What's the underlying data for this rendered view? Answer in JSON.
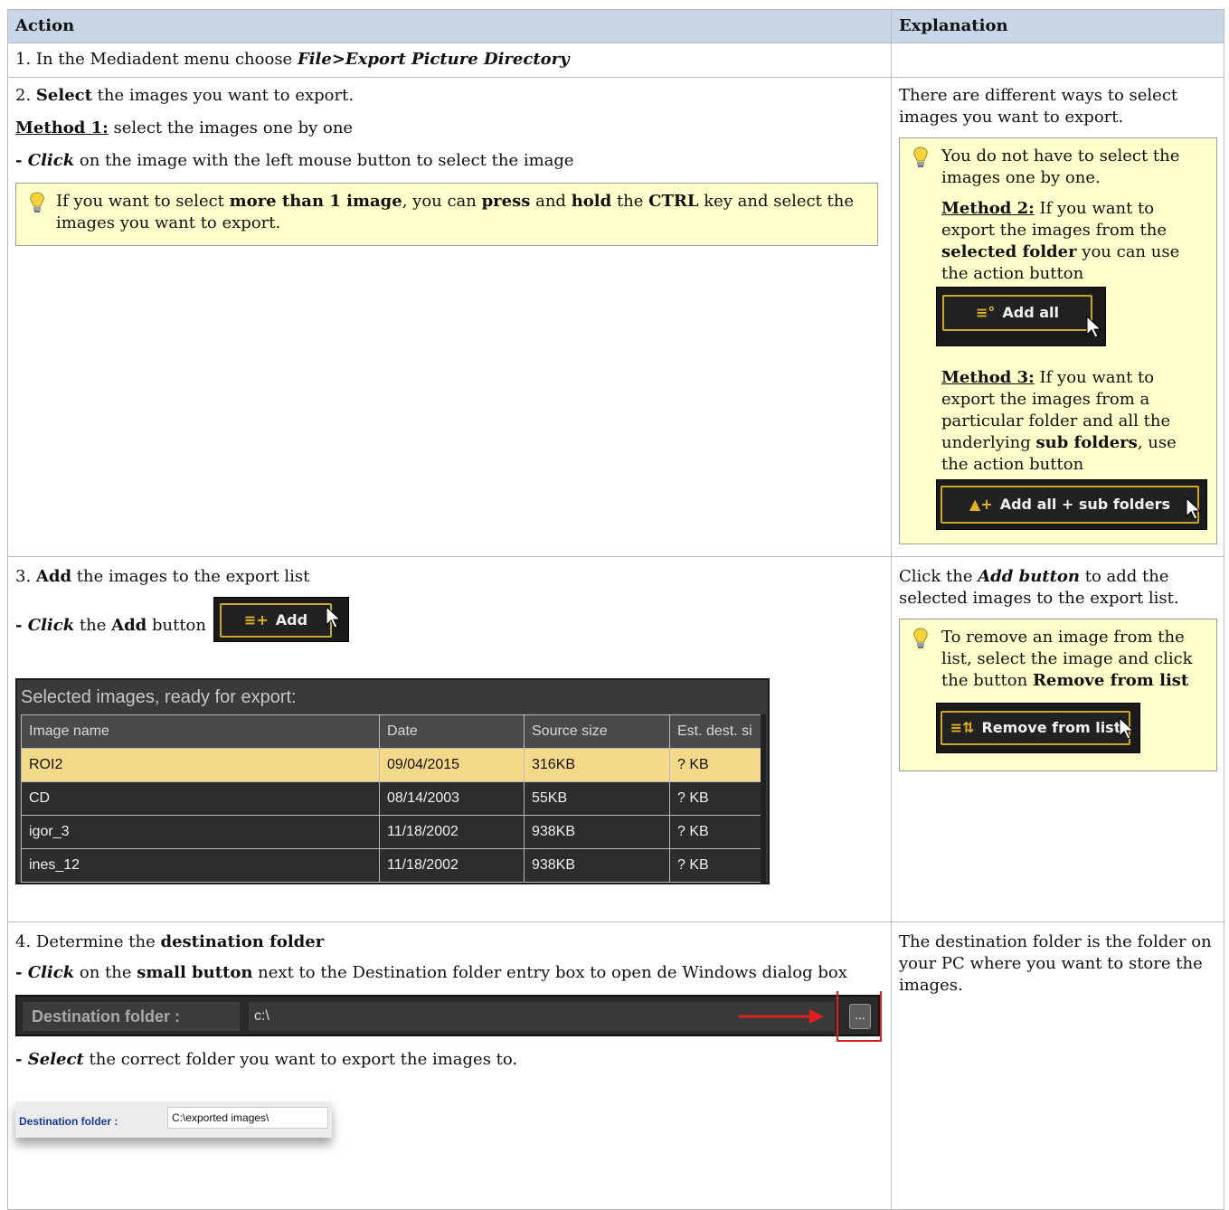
{
  "table": {
    "header": {
      "action": "Action",
      "explanation": "Explanation"
    },
    "row1": {
      "action": {
        "prefix": "1. In the Mediadent menu choose ",
        "menu_path": "File>Export Picture Directory"
      },
      "explanation": ""
    },
    "row2": {
      "step_num": "2. ",
      "step_bold": "Select",
      "step_rest": " the images you want to export.",
      "method1_label": "Method 1:",
      "method1_text": " select the images one by one",
      "click_dash": "- ",
      "click_word": "Click",
      "click_text": " on the image with the left mouse button to select the image",
      "tip": {
        "t1": "If you want to select ",
        "b1": "more than 1 image",
        "t2": ", you can ",
        "b2": "press",
        "t3": " and ",
        "b3": "hold",
        "t4": " the ",
        "b4": "CTRL",
        "t5": " key and select the images you want to export."
      },
      "explanation": {
        "intro": "There are different ways to select images you want to export.",
        "tip_line": "You do not have to select the images one by one.",
        "method2_label": "Method 2:",
        "method2_a": " If you want to export the images from the ",
        "method2_bold": "selected folder",
        "method2_b": " you can use the action button",
        "add_all_button": "Add all",
        "method3_label": "Method 3:",
        "method3_a": " If you want to export the images from a particular folder and all the underlying ",
        "method3_bold": "sub folders",
        "method3_b": ", use the action button",
        "add_all_sub_button": "Add all + sub folders"
      }
    },
    "row3": {
      "step_num": "3. ",
      "step_bold": "Add",
      "step_rest": " the images to the export list",
      "click_dash": "- ",
      "click_word": "Click",
      "click_mid": " the ",
      "click_bold": "Add",
      "click_end": " button",
      "add_button": "Add",
      "grid": {
        "title": "Selected images, ready for export:",
        "columns": [
          "Image name",
          "Date",
          "Source size",
          "Est. dest. si"
        ],
        "rows": [
          [
            "ROI2",
            "09/04/2015",
            "316KB",
            "? KB"
          ],
          [
            "CD",
            "08/14/2003",
            "55KB",
            "? KB"
          ],
          [
            "igor_3",
            "11/18/2002",
            "938KB",
            "? KB"
          ],
          [
            "ines_12",
            "11/18/2002",
            "938KB",
            "? KB"
          ]
        ],
        "selected_row": 0
      },
      "explanation": {
        "t1": "Click the ",
        "b1": "Add button",
        "t2": " to add the selected images to the export list.",
        "tip_a": "To remove an image from the list, select the image and click the button ",
        "tip_bold": "Remove from list",
        "remove_button": "Remove from list"
      }
    },
    "row4": {
      "step_num": "4. ",
      "step_rest": "Determine the ",
      "step_bold": "destination folder",
      "click_dash": "- ",
      "click_word": "Click",
      "click_a": " on the ",
      "click_bold": "small button",
      "click_b": " next to the Destination folder entry box to open de Windows dialog box",
      "dest_label": "Destination folder :",
      "dest_value": "c:\\",
      "browse_label": "...",
      "select_dash": "- ",
      "select_word": "Select",
      "select_text": " the correct folder you want to export the images to.",
      "dest2_label": "Destination folder :",
      "dest2_value": "C:\\exported images\\",
      "explanation": "The destination folder is the folder on your PC where you want to store the images."
    }
  },
  "colors": {
    "header_bg": "#c8d6e8",
    "tip_bg": "#ffffcc",
    "button_border": "#c9a82a",
    "selected_row": "#f5d98a",
    "arrow_red": "#e01e1e"
  },
  "icons": [
    "lightbulb-icon",
    "add-all-icon",
    "add-folder-icon",
    "add-icon",
    "remove-icon",
    "mouse-cursor-icon",
    "red-arrow-icon"
  ]
}
